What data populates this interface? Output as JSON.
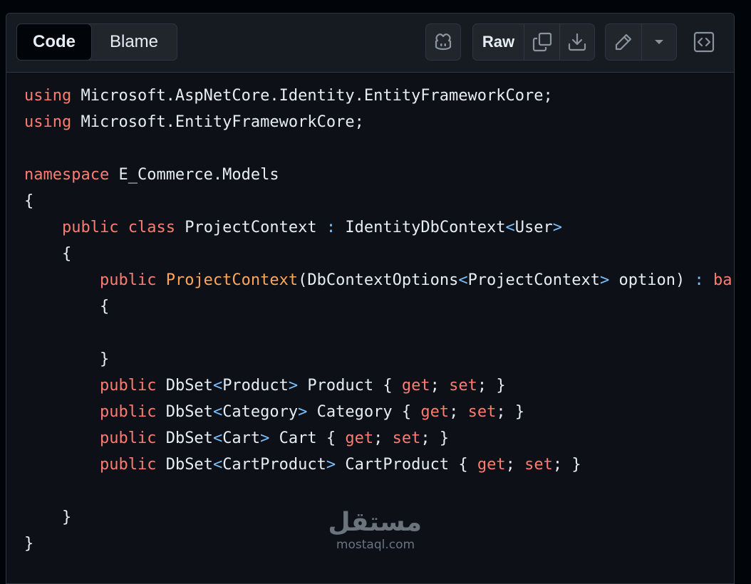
{
  "toolbar": {
    "tabs": [
      {
        "label": "Code",
        "active": true
      },
      {
        "label": "Blame",
        "active": false
      }
    ],
    "raw_label": "Raw",
    "icons": [
      "copilot-icon",
      "copy-icon",
      "download-icon",
      "pencil-icon",
      "triangle-down-icon",
      "code-square-icon"
    ]
  },
  "code": {
    "lines": [
      [
        {
          "t": "using",
          "c": "kw"
        },
        {
          "t": " Microsoft.AspNetCore.Identity.EntityFrameworkCore;"
        }
      ],
      [
        {
          "t": "using",
          "c": "kw"
        },
        {
          "t": " Microsoft.EntityFrameworkCore;"
        }
      ],
      [],
      [
        {
          "t": "namespace",
          "c": "kw"
        },
        {
          "t": " E_Commerce.Models"
        }
      ],
      [
        {
          "t": "{"
        }
      ],
      [
        {
          "t": "    "
        },
        {
          "t": "public",
          "c": "kw"
        },
        {
          "t": " "
        },
        {
          "t": "class",
          "c": "kw"
        },
        {
          "t": " ProjectContext "
        },
        {
          "t": ":",
          "c": "op"
        },
        {
          "t": " IdentityDbContext"
        },
        {
          "t": "<",
          "c": "op"
        },
        {
          "t": "User"
        },
        {
          "t": ">",
          "c": "op"
        }
      ],
      [
        {
          "t": "    {"
        }
      ],
      [
        {
          "t": "        "
        },
        {
          "t": "public",
          "c": "kw"
        },
        {
          "t": " "
        },
        {
          "t": "ProjectContext",
          "c": "fn"
        },
        {
          "t": "(DbContextOptions"
        },
        {
          "t": "<",
          "c": "op"
        },
        {
          "t": "ProjectContext"
        },
        {
          "t": ">",
          "c": "op"
        },
        {
          "t": " option) "
        },
        {
          "t": ":",
          "c": "op"
        },
        {
          "t": " "
        },
        {
          "t": "ba",
          "c": "kw"
        }
      ],
      [
        {
          "t": "        {"
        }
      ],
      [],
      [
        {
          "t": "        }"
        }
      ],
      [
        {
          "t": "        "
        },
        {
          "t": "public",
          "c": "kw"
        },
        {
          "t": " DbSet"
        },
        {
          "t": "<",
          "c": "op"
        },
        {
          "t": "Product"
        },
        {
          "t": ">",
          "c": "op"
        },
        {
          "t": " Product { "
        },
        {
          "t": "get",
          "c": "kw"
        },
        {
          "t": "; "
        },
        {
          "t": "set",
          "c": "kw"
        },
        {
          "t": "; }"
        }
      ],
      [
        {
          "t": "        "
        },
        {
          "t": "public",
          "c": "kw"
        },
        {
          "t": " DbSet"
        },
        {
          "t": "<",
          "c": "op"
        },
        {
          "t": "Category"
        },
        {
          "t": ">",
          "c": "op"
        },
        {
          "t": " Category { "
        },
        {
          "t": "get",
          "c": "kw"
        },
        {
          "t": "; "
        },
        {
          "t": "set",
          "c": "kw"
        },
        {
          "t": "; }"
        }
      ],
      [
        {
          "t": "        "
        },
        {
          "t": "public",
          "c": "kw"
        },
        {
          "t": " DbSet"
        },
        {
          "t": "<",
          "c": "op"
        },
        {
          "t": "Cart"
        },
        {
          "t": ">",
          "c": "op"
        },
        {
          "t": " Cart { "
        },
        {
          "t": "get",
          "c": "kw"
        },
        {
          "t": "; "
        },
        {
          "t": "set",
          "c": "kw"
        },
        {
          "t": "; }"
        }
      ],
      [
        {
          "t": "        "
        },
        {
          "t": "public",
          "c": "kw"
        },
        {
          "t": " DbSet"
        },
        {
          "t": "<",
          "c": "op"
        },
        {
          "t": "CartProduct"
        },
        {
          "t": ">",
          "c": "op"
        },
        {
          "t": " CartProduct { "
        },
        {
          "t": "get",
          "c": "kw"
        },
        {
          "t": "; "
        },
        {
          "t": "set",
          "c": "kw"
        },
        {
          "t": "; }"
        }
      ],
      [],
      [
        {
          "t": "    }"
        }
      ],
      [
        {
          "t": "}"
        }
      ]
    ]
  },
  "watermark": {
    "arabic": "مستقل",
    "latin": "mostaql.com"
  },
  "colors": {
    "keyword": "#ff7b72",
    "function": "#ffa657",
    "operator": "#79c0ff",
    "text": "#e6edf3",
    "background": "#0d1117"
  }
}
